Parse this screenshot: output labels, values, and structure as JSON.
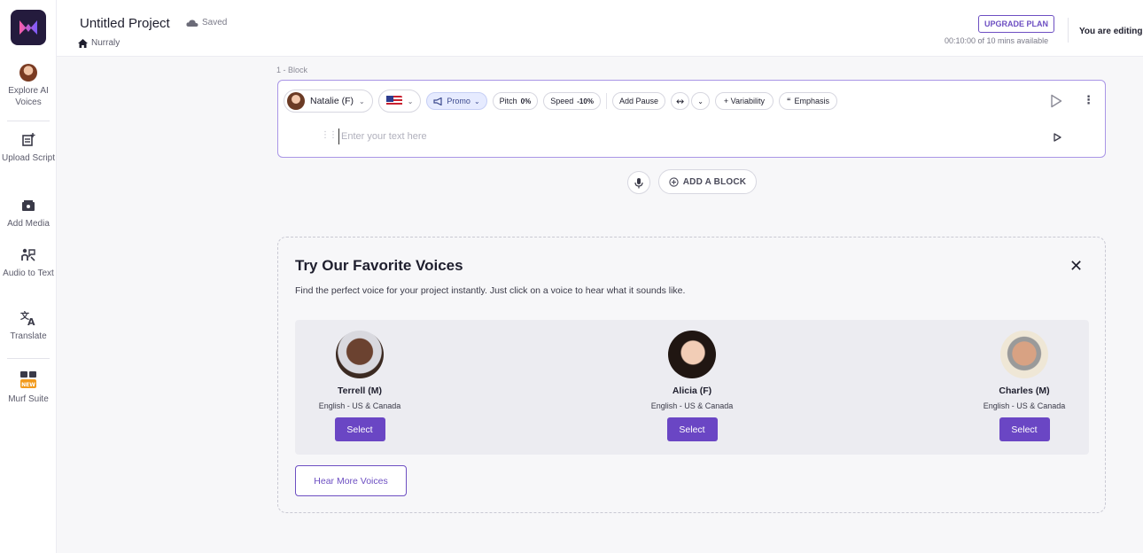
{
  "header": {
    "project_title": "Untitled Project",
    "saved_label": "Saved",
    "breadcrumb": "Nurraly",
    "upgrade_label": "UPGRADE PLAN",
    "time_available": "00:10:00 of 10 mins available",
    "editing_label": "You are editing"
  },
  "sidebar": {
    "items": [
      {
        "label": "Explore AI Voices",
        "icon": "voice-avatar-icon"
      },
      {
        "label": "Upload Script",
        "icon": "upload-script-icon"
      },
      {
        "label": "Add Media",
        "icon": "add-media-icon"
      },
      {
        "label": "Audio to Text",
        "icon": "audio-to-text-icon"
      },
      {
        "label": "Translate",
        "icon": "translate-icon"
      },
      {
        "label": "Murf Suite",
        "icon": "murf-suite-icon",
        "badge": "NEW"
      }
    ]
  },
  "block": {
    "label": "1 -  Block",
    "voice_name": "Natalie (F)",
    "style": "Promo",
    "pitch_label": "Pitch",
    "pitch_value": "0%",
    "speed_label": "Speed",
    "speed_value": "-10%",
    "add_pause": "Add Pause",
    "variability": "+ Variability",
    "emphasis": "Emphasis",
    "text_placeholder": "Enter your text here"
  },
  "add_block_label": "ADD A BLOCK",
  "favorites": {
    "title": "Try Our Favorite Voices",
    "description": "Find the perfect voice for your project instantly. Just click on a voice to hear what it sounds like.",
    "voices": [
      {
        "name": "Terrell (M)",
        "language": "English - US & Canada",
        "select_label": "Select"
      },
      {
        "name": "Alicia (F)",
        "language": "English - US & Canada",
        "select_label": "Select"
      },
      {
        "name": "Charles (M)",
        "language": "English - US & Canada",
        "select_label": "Select"
      }
    ],
    "hear_more": "Hear More Voices"
  },
  "colors": {
    "accent": "#6a46c4",
    "block_border": "#a996e6",
    "canvas_bg": "#f7f7f9"
  }
}
